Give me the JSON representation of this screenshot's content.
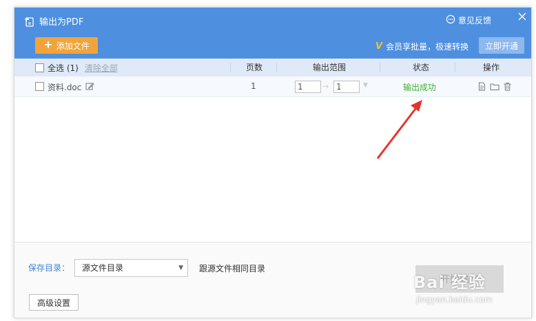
{
  "window": {
    "title": "输出为PDF",
    "feedback_label": "意见反馈",
    "close_icon": "close-icon"
  },
  "toolbar": {
    "add_file_label": "添加文件",
    "vip_text": "会员享批量，极速转换",
    "open_now_label": "立即开通"
  },
  "table": {
    "select_all_label": "全选 (1)",
    "clear_all_label": "清除全部",
    "columns": [
      "页数",
      "输出范围",
      "状态",
      "操作"
    ],
    "rows": [
      {
        "file_name": "资料.doc",
        "pages": "1",
        "range_from": "1",
        "range_to": "1",
        "status": "输出成功"
      }
    ]
  },
  "footer": {
    "save_dir_label": "保存目录：",
    "save_dir_value": "源文件目录",
    "save_dir_desc": "跟源文件相同目录",
    "start_label": "开始输出",
    "advanced_label": "高级设置"
  },
  "watermark": {
    "main": "Bai 经验",
    "sub": "jingyan.baidu.com"
  },
  "colors": {
    "title_bar": "#4e8fe0",
    "add_button": "#f2a43a",
    "open_button": "#8db8ee",
    "success": "#3db134",
    "annotation_arrow": "#e8322b"
  }
}
